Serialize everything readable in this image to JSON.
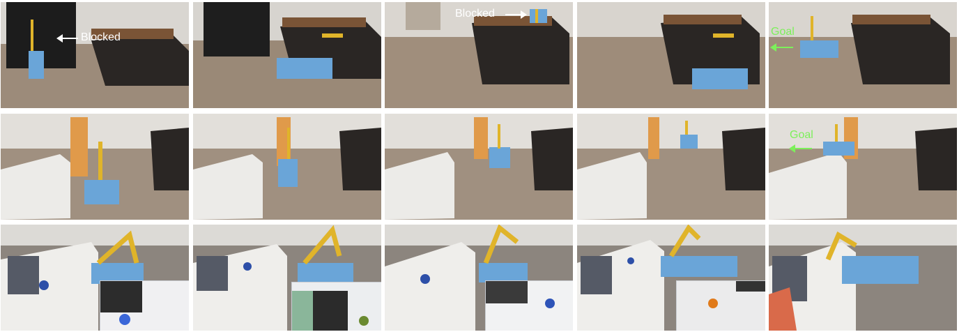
{
  "annotations": {
    "blocked_1": "Blocked",
    "blocked_2": "Blocked",
    "goal_1": "Goal",
    "goal_2": "Goal"
  },
  "colors": {
    "annotation_white": "#ffffff",
    "annotation_green": "#7cf05a",
    "robot_body": "#6aa5d8",
    "robot_arm": "#e0b42a"
  },
  "rows": [
    {
      "scene": "kitchen-island",
      "frames": 5
    },
    {
      "scene": "living-room-sofa-person",
      "frames": 5
    },
    {
      "scene": "sofa-ball-pickup",
      "frames": 5
    }
  ]
}
